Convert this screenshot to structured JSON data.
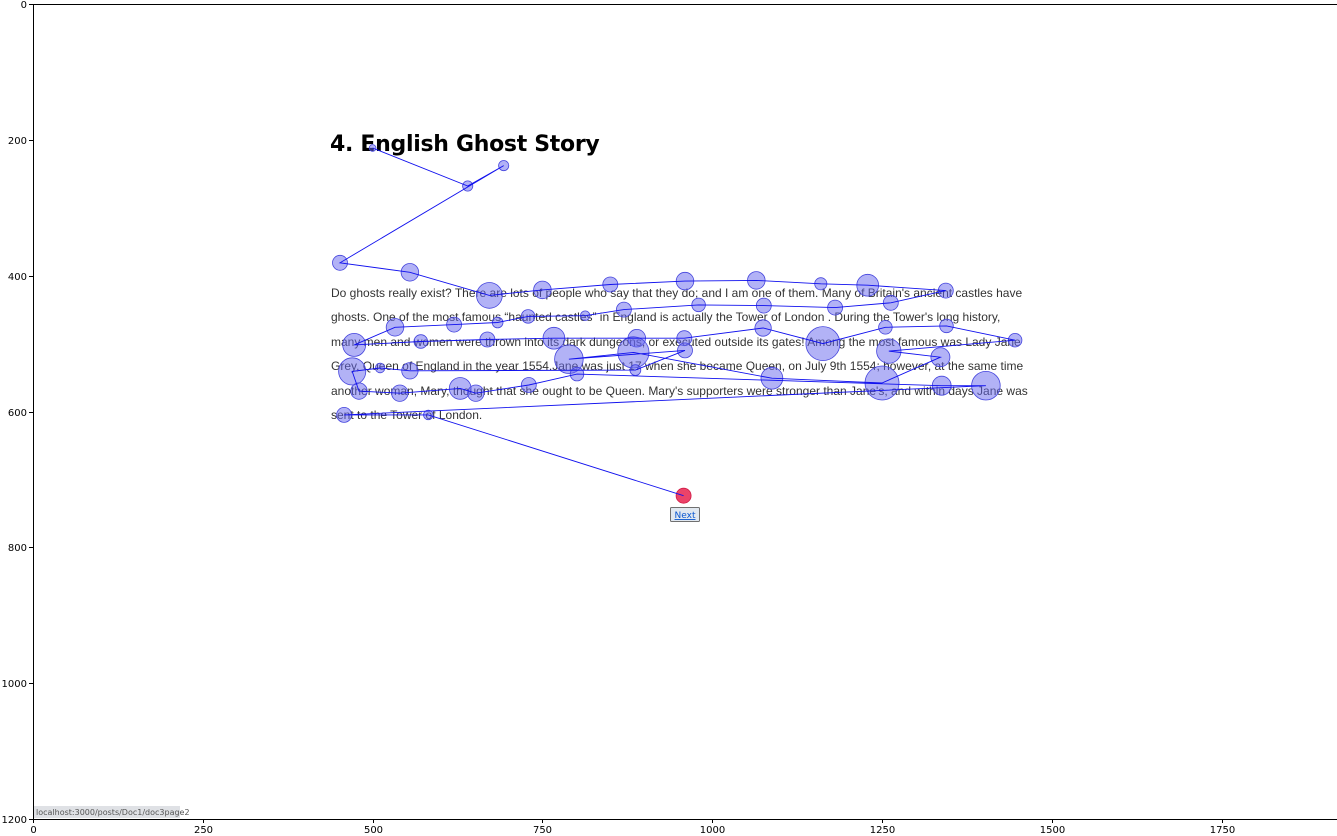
{
  "page": {
    "title": "4. English Ghost Story",
    "body_lines": [
      "Do ghosts really exist? There are lots of people who say that they do; and I am one of them. Many of Britain's ancient castles have",
      "ghosts. One of the most famous “haunted castles” in England is actually the Tower of London . During the Tower's long history,",
      "many men and women were thrown into its dark dungeons, or executed outside its gates! Among the most famous was Lady Jane",
      "Grey, Queen of England in the year 1554.Jane was just 17 when she became Queen, on July 9th 1554; however, at the same time",
      "another woman, Mary, thought that she ought to be Queen. Mary's supporters were stronger than Jane's, and within days Jane was",
      "sent to the Tower of London."
    ],
    "next_label": "Next",
    "status_url": "localhost:3000/posts/Doc1/doc3page2"
  },
  "colors": {
    "fixation": "#6666ee",
    "scanpath": "#1111ee",
    "final_fixation": "#e8224f"
  },
  "chart_data": {
    "type": "scatter",
    "title": "",
    "xlabel": "",
    "ylabel": "",
    "xlim": [
      0,
      1920
    ],
    "ylim": [
      1200,
      0
    ],
    "xticks": [
      0,
      250,
      500,
      750,
      1000,
      1250,
      1500,
      1750
    ],
    "yticks": [
      0,
      200,
      400,
      600,
      800,
      1000,
      1200
    ],
    "grid": false,
    "series": [
      {
        "points": [
          [
            500,
            212,
            10
          ],
          [
            640,
            268,
            15
          ],
          [
            693,
            238,
            15
          ],
          [
            452,
            381,
            22
          ],
          [
            555,
            395,
            26
          ],
          [
            672,
            429,
            38
          ],
          [
            750,
            421,
            26
          ],
          [
            850,
            413,
            22
          ],
          [
            960,
            408,
            26
          ],
          [
            1065,
            407,
            26
          ],
          [
            1160,
            412,
            18
          ],
          [
            1229,
            414,
            32
          ],
          [
            1344,
            422,
            22
          ],
          [
            1263,
            440,
            22
          ],
          [
            1181,
            447,
            22
          ],
          [
            1076,
            444,
            22
          ],
          [
            980,
            443,
            20
          ],
          [
            870,
            450,
            22
          ],
          [
            813,
            459,
            14
          ],
          [
            729,
            460,
            20
          ],
          [
            684,
            469,
            16
          ],
          [
            620,
            472,
            22
          ],
          [
            533,
            476,
            26
          ],
          [
            473,
            502,
            34
          ],
          [
            571,
            497,
            20
          ],
          [
            669,
            494,
            22
          ],
          [
            767,
            492,
            32
          ],
          [
            889,
            492,
            26
          ],
          [
            959,
            492,
            22
          ],
          [
            1075,
            477,
            24
          ],
          [
            1163,
            500,
            50
          ],
          [
            1255,
            476,
            20
          ],
          [
            1345,
            474,
            20
          ],
          [
            1446,
            495,
            20
          ],
          [
            1260,
            511,
            36
          ],
          [
            1336,
            520,
            28
          ],
          [
            1250,
            558,
            50
          ],
          [
            1088,
            551,
            32
          ],
          [
            884,
            513,
            46
          ],
          [
            789,
            523,
            42
          ],
          [
            960,
            510,
            22
          ],
          [
            887,
            539,
            16
          ],
          [
            555,
            540,
            24
          ],
          [
            511,
            536,
            14
          ],
          [
            470,
            541,
            40
          ],
          [
            480,
            570,
            24
          ],
          [
            540,
            573,
            24
          ],
          [
            629,
            566,
            32
          ],
          [
            652,
            573,
            24
          ],
          [
            730,
            561,
            22
          ],
          [
            801,
            545,
            20
          ],
          [
            1338,
            562,
            28
          ],
          [
            1403,
            562,
            42
          ],
          [
            458,
            605,
            22
          ],
          [
            582,
            605,
            14
          ],
          [
            958,
            724,
            22,
            "final"
          ]
        ]
      }
    ]
  }
}
